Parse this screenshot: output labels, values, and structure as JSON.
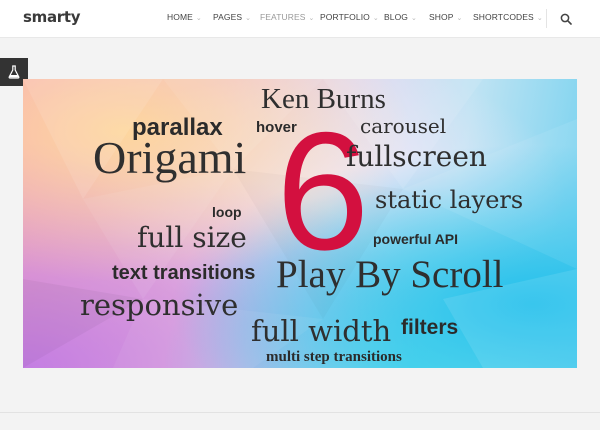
{
  "brand": {
    "logo": "smarty"
  },
  "nav": {
    "items": [
      {
        "label": "HOME",
        "active": false
      },
      {
        "label": "PAGES",
        "active": false
      },
      {
        "label": "FEATURES",
        "active": true
      },
      {
        "label": "PORTFOLIO",
        "active": false
      },
      {
        "label": "BLOG",
        "active": false
      },
      {
        "label": "SHOP",
        "active": false
      },
      {
        "label": "SHORTCODES",
        "active": false
      }
    ]
  },
  "side_tab": {
    "icon": "flask-icon"
  },
  "banner": {
    "number": "6",
    "words": [
      "Ken Burns",
      "parallax",
      "hover",
      "carousel",
      "Origami",
      "fullscreen",
      "static layers",
      "loop",
      "full size",
      "powerful API",
      "text transitions",
      "Play By Scroll",
      "responsive",
      "full width",
      "filters",
      "multi step transitions"
    ]
  },
  "colors": {
    "accent": "#d3103f",
    "topbar_bg": "#ffffff",
    "side_tab_bg": "#333333",
    "page_bg": "#f3f3f3"
  }
}
